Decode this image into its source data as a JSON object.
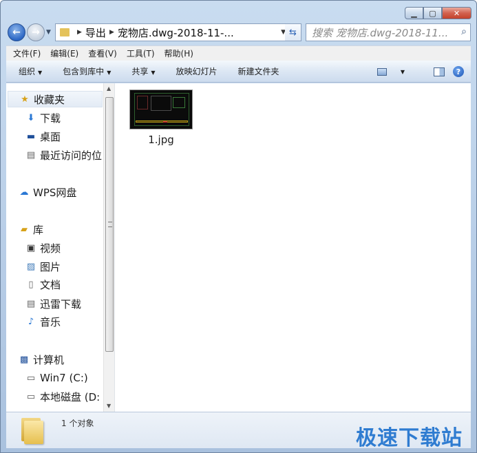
{
  "window": {
    "caption_buttons": [
      "minimize",
      "maximize",
      "close"
    ]
  },
  "navigation": {
    "breadcrumbs": [
      "导出",
      "宠物店.dwg-2018-11-..."
    ],
    "search_placeholder": "搜索 宠物店.dwg-2018-11..."
  },
  "menubar": {
    "items": [
      "文件(F)",
      "编辑(E)",
      "查看(V)",
      "工具(T)",
      "帮助(H)"
    ]
  },
  "toolbar": {
    "organize": "组织",
    "include_library": "包含到库中",
    "share": "共享",
    "slideshow": "放映幻灯片",
    "new_folder": "新建文件夹"
  },
  "sidebar": {
    "items": [
      {
        "label": "收藏夹",
        "icon": "star-icon"
      },
      {
        "label": "下载",
        "icon": "downloads-folder-icon"
      },
      {
        "label": "桌面",
        "icon": "desktop-icon"
      },
      {
        "label": "最近访问的位",
        "icon": "recent-places-icon"
      },
      {
        "label": "WPS网盘",
        "icon": "cloud-icon"
      },
      {
        "label": "库",
        "icon": "library-icon"
      },
      {
        "label": "视频",
        "icon": "video-icon"
      },
      {
        "label": "图片",
        "icon": "pictures-icon"
      },
      {
        "label": "文档",
        "icon": "documents-icon"
      },
      {
        "label": "迅雷下载",
        "icon": "xunlei-download-icon"
      },
      {
        "label": "音乐",
        "icon": "music-icon"
      },
      {
        "label": "计算机",
        "icon": "computer-icon"
      },
      {
        "label": "Win7 (C:)",
        "icon": "system-drive-icon"
      },
      {
        "label": "本地磁盘 (D:",
        "icon": "local-drive-icon"
      }
    ]
  },
  "files": [
    {
      "name": "1.jpg",
      "icon": "jpg-thumbnail"
    }
  ],
  "details": {
    "count": "1 个对象"
  },
  "watermark": {
    "text": "极速下载站"
  },
  "colors": {
    "chrome_blue": "#b6cce6",
    "watermark_blue": "#2f7cd1",
    "folder_yellow": "#e6bf4e"
  }
}
